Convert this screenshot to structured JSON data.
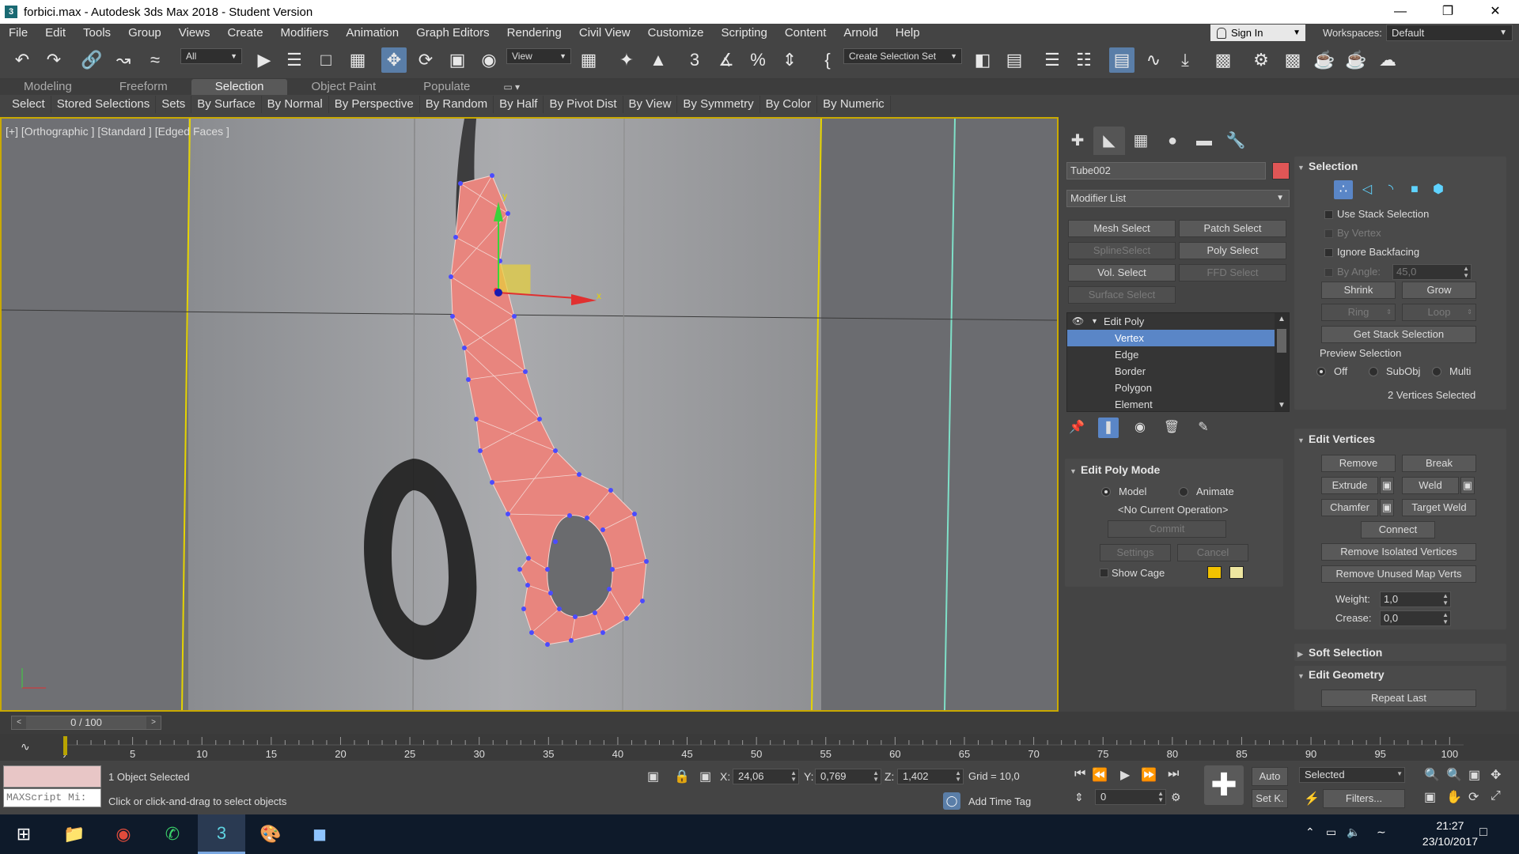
{
  "window": {
    "title": "forbici.max - Autodesk 3ds Max 2018 - Student Version",
    "app_icon": "3"
  },
  "menu": [
    "File",
    "Edit",
    "Tools",
    "Group",
    "Views",
    "Create",
    "Modifiers",
    "Animation",
    "Graph Editors",
    "Rendering",
    "Civil View",
    "Customize",
    "Scripting",
    "Content",
    "Arnold",
    "Help"
  ],
  "signin": {
    "label": "Sign In"
  },
  "workspace": {
    "label": "Workspaces:",
    "value": "Default"
  },
  "toolbar": {
    "filter": "All",
    "refcoord": "View",
    "selection_set": "Create Selection Set"
  },
  "ribbon_tabs": [
    "Modeling",
    "Freeform",
    "Selection",
    "Object Paint",
    "Populate"
  ],
  "ribbon_active": 2,
  "selection_bar": [
    "Select",
    "Stored Selections",
    "Sets",
    "By Surface",
    "By Normal",
    "By Perspective",
    "By Random",
    "By Half",
    "By Pivot Dist",
    "By View",
    "By Symmetry",
    "By Color",
    "By Numeric"
  ],
  "viewport": {
    "label": "[+] [Orthographic ] [Standard ] [Edged Faces ]",
    "gizmo_x": "x",
    "gizmo_y": "y"
  },
  "command_panel": {
    "object_name": "Tube002",
    "object_color": "#e05656",
    "modifier_list": "Modifier List",
    "modifier_buttons": [
      "Mesh Select",
      "Patch Select",
      "SplineSelect",
      "Poly Select",
      "Vol. Select",
      "FFD Select",
      "Surface Select"
    ],
    "stack": {
      "root": "Edit Poly",
      "items": [
        "Vertex",
        "Edge",
        "Border",
        "Polygon",
        "Element"
      ],
      "selected": 0
    }
  },
  "edit_poly_mode": {
    "title": "Edit Poly Mode",
    "model": "Model",
    "animate": "Animate",
    "operation": "<No Current Operation>",
    "commit": "Commit",
    "settings": "Settings",
    "cancel": "Cancel",
    "show_cage": "Show Cage"
  },
  "selection_rollout": {
    "title": "Selection",
    "use_stack": "Use Stack Selection",
    "by_vertex": "By Vertex",
    "ignore_backfacing": "Ignore Backfacing",
    "by_angle": "By Angle:",
    "angle_value": "45,0",
    "shrink": "Shrink",
    "grow": "Grow",
    "ring": "Ring",
    "loop": "Loop",
    "get_stack": "Get Stack Selection",
    "preview": "Preview Selection",
    "off": "Off",
    "subobj": "SubObj",
    "multi": "Multi",
    "status": "2 Vertices Selected"
  },
  "edit_vertices": {
    "title": "Edit Vertices",
    "remove": "Remove",
    "break": "Break",
    "extrude": "Extrude",
    "weld": "Weld",
    "chamfer": "Chamfer",
    "target_weld": "Target Weld",
    "connect": "Connect",
    "remove_isolated": "Remove Isolated Vertices",
    "remove_unused": "Remove Unused Map Verts",
    "weight_label": "Weight:",
    "weight": "1,0",
    "crease_label": "Crease:",
    "crease": "0,0"
  },
  "soft_selection": {
    "title": "Soft Selection"
  },
  "edit_geometry": {
    "title": "Edit Geometry",
    "repeat_last": "Repeat Last"
  },
  "timeline": {
    "slider": "0 / 100",
    "ticks": [
      "0",
      "5",
      "10",
      "15",
      "20",
      "25",
      "30",
      "35",
      "40",
      "45",
      "50",
      "55",
      "60",
      "65",
      "70",
      "75",
      "80",
      "85",
      "90",
      "95",
      "100"
    ]
  },
  "status": {
    "maxscript": "MAXScript Mi:",
    "selected": "1 Object Selected",
    "prompt": "Click or click-and-drag to select objects",
    "x_label": "X:",
    "x": "24,06",
    "y_label": "Y:",
    "y": "0,769",
    "z_label": "Z:",
    "z": "1,402",
    "grid": "Grid = 10,0",
    "add_time_tag": "Add Time Tag",
    "auto": "Auto",
    "set_k": "Set K.",
    "selected_dropdown": "Selected",
    "filters": "Filters...",
    "frame": "0"
  },
  "taskbar": {
    "time": "21:27",
    "date": "23/10/2017"
  }
}
